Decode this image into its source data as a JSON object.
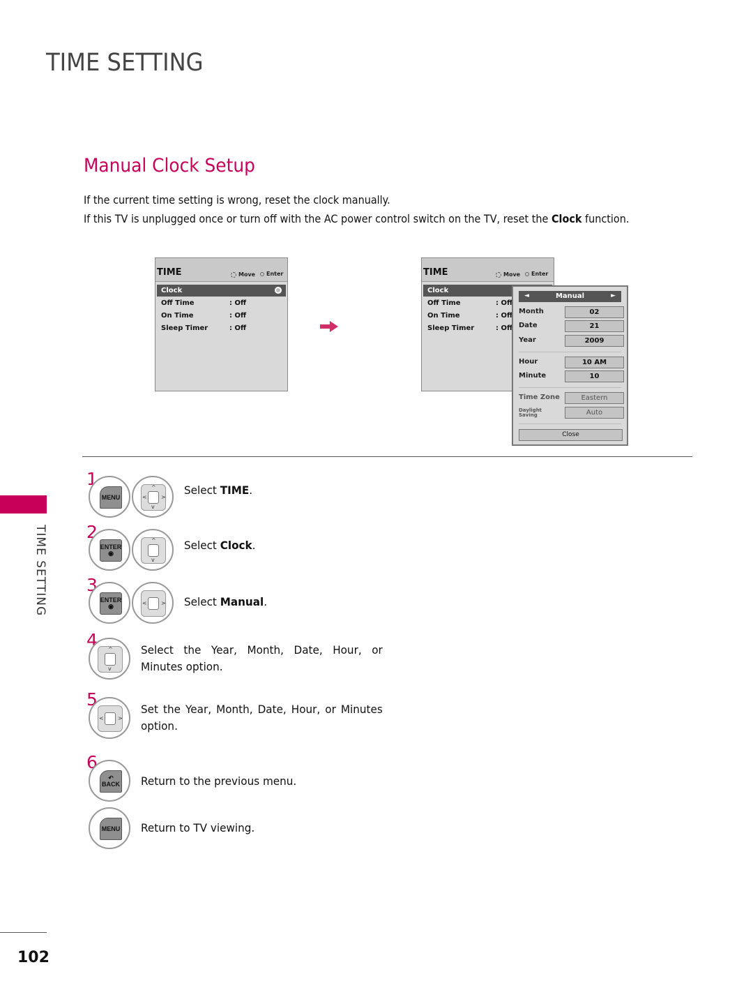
{
  "page": {
    "title": "TIME SETTING",
    "section_title": "Manual Clock Setup",
    "intro": [
      {
        "pre": "If the current time setting is wrong, reset the clock manually.",
        "bold": "",
        "post": ""
      },
      {
        "pre": "If this TV is unplugged once or turn off with the AC power control switch on the TV, reset the ",
        "bold": "Clock",
        "post": " function."
      }
    ],
    "side_label": "TIME SETTING",
    "page_number": "102",
    "accent_color": "#c8005a"
  },
  "osd_left": {
    "title": "TIME",
    "hint_move": "Move",
    "hint_enter": "Enter",
    "rows": [
      {
        "label": "Clock",
        "value": "",
        "selected": true
      },
      {
        "label": "Off Time",
        "value": ": Off"
      },
      {
        "label": "On Time",
        "value": ": Off"
      },
      {
        "label": "Sleep Timer",
        "value": ": Off"
      }
    ]
  },
  "osd_right": {
    "title": "TIME",
    "hint_move": "Move",
    "hint_enter": "Enter",
    "rows": [
      {
        "label": "Clock",
        "value": "",
        "selected": true
      },
      {
        "label": "Off Time",
        "value": ": Off"
      },
      {
        "label": "On Time",
        "value": ": Off"
      },
      {
        "label": "Sleep Timer",
        "value": ": Off"
      }
    ],
    "popup": {
      "mode": "Manual",
      "left_arrow": "◄",
      "right_arrow": "►",
      "fields": [
        {
          "label": "Month",
          "value": "02"
        },
        {
          "label": "Date",
          "value": "21"
        },
        {
          "label": "Year",
          "value": "2009"
        },
        {
          "label": "Hour",
          "value": "10 AM"
        },
        {
          "label": "Minute",
          "value": "10"
        },
        {
          "label": "Time Zone",
          "value": "Eastern"
        },
        {
          "label": "Daylight Saving",
          "label_line1": "Daylight",
          "label_line2": "Saving",
          "value": "Auto"
        }
      ],
      "close_label": "Close"
    }
  },
  "steps": [
    {
      "num": "1",
      "keys": [
        "MENU",
        "dpad-4way"
      ],
      "text_pre": "Select ",
      "text_bold": "TIME",
      "text_post": "."
    },
    {
      "num": "2",
      "keys": [
        "ENTER",
        "dpad-updown"
      ],
      "text_pre": "Select ",
      "text_bold": "Clock",
      "text_post": "."
    },
    {
      "num": "3",
      "keys": [
        "ENTER",
        "dpad-leftright"
      ],
      "text_pre": "Select ",
      "text_bold": "Manual",
      "text_post": "."
    },
    {
      "num": "4",
      "keys": [
        "dpad-updown"
      ],
      "text": "Select the Year, Month, Date, Hour, or Minutes option."
    },
    {
      "num": "5",
      "keys": [
        "dpad-leftright"
      ],
      "text": "Set the Year, Month, Date, Hour, or Minutes option."
    },
    {
      "num": "6",
      "keys": [
        "BACK"
      ],
      "text": "Return to the previous menu."
    },
    {
      "num": "",
      "keys": [
        "MENU"
      ],
      "text": "Return to TV viewing."
    }
  ],
  "keys": {
    "menu": "MENU",
    "enter": "ENTER",
    "back": "BACK",
    "up": "^",
    "down": "v",
    "left": "<",
    "right": ">"
  }
}
